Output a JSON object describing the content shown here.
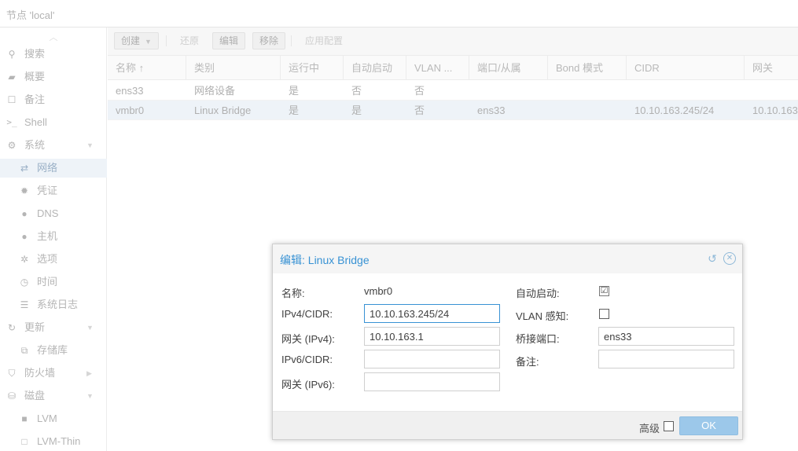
{
  "header": {
    "title": "节点 'local'"
  },
  "sidebar": {
    "items": [
      {
        "label": "搜索",
        "icon": "search-icon"
      },
      {
        "label": "概要",
        "icon": "book-icon"
      },
      {
        "label": "备注",
        "icon": "note-icon"
      },
      {
        "label": "Shell",
        "icon": "terminal-icon"
      },
      {
        "label": "系统",
        "icon": "gears-icon"
      },
      {
        "label": "网络",
        "icon": "exchange-icon"
      },
      {
        "label": "凭证",
        "icon": "certificate-icon"
      },
      {
        "label": "DNS",
        "icon": "globe-icon"
      },
      {
        "label": "主机",
        "icon": "globe-icon"
      },
      {
        "label": "选项",
        "icon": "gear-icon"
      },
      {
        "label": "时间",
        "icon": "clock-icon"
      },
      {
        "label": "系统日志",
        "icon": "list-icon"
      },
      {
        "label": "更新",
        "icon": "refresh-icon"
      },
      {
        "label": "存储库",
        "icon": "files-icon"
      },
      {
        "label": "防火墙",
        "icon": "shield-icon"
      },
      {
        "label": "磁盘",
        "icon": "hdd-icon"
      },
      {
        "label": "LVM",
        "icon": "square-icon"
      },
      {
        "label": "LVM-Thin",
        "icon": "square-outline-icon"
      }
    ]
  },
  "toolbar": {
    "create": "创建",
    "revert": "还原",
    "edit": "编辑",
    "remove": "移除",
    "apply": "应用配置"
  },
  "grid": {
    "columns": [
      "名称 ↑",
      "类别",
      "运行中",
      "自动启动",
      "VLAN ...",
      "端口/从属",
      "Bond 模式",
      "CIDR",
      "网关"
    ],
    "rows": [
      [
        "ens33",
        "网络设备",
        "是",
        "否",
        "否",
        "",
        "",
        "",
        ""
      ],
      [
        "vmbr0",
        "Linux Bridge",
        "是",
        "是",
        "否",
        "ens33",
        "",
        "10.10.163.245/24",
        "10.10.163"
      ]
    ]
  },
  "dialog": {
    "title": "编辑: Linux Bridge",
    "name_label": "名称:",
    "name_value": "vmbr0",
    "ipv4_label": "IPv4/CIDR:",
    "ipv4_value": "10.10.163.245/24",
    "gw4_label": "网关 (IPv4):",
    "gw4_value": "10.10.163.1",
    "ipv6_label": "IPv6/CIDR:",
    "ipv6_value": "",
    "gw6_label": "网关 (IPv6):",
    "gw6_value": "",
    "autostart_label": "自动启动:",
    "autostart_checked": "☑",
    "vlan_label": "VLAN 感知:",
    "bridge_ports_label": "桥接端口:",
    "bridge_ports_value": "ens33",
    "comment_label": "备注:",
    "comment_value": "",
    "advanced_label": "高级",
    "ok_label": "OK"
  },
  "colors": {
    "accent": "#3892d4",
    "ok_button": "#9cc8ea"
  }
}
